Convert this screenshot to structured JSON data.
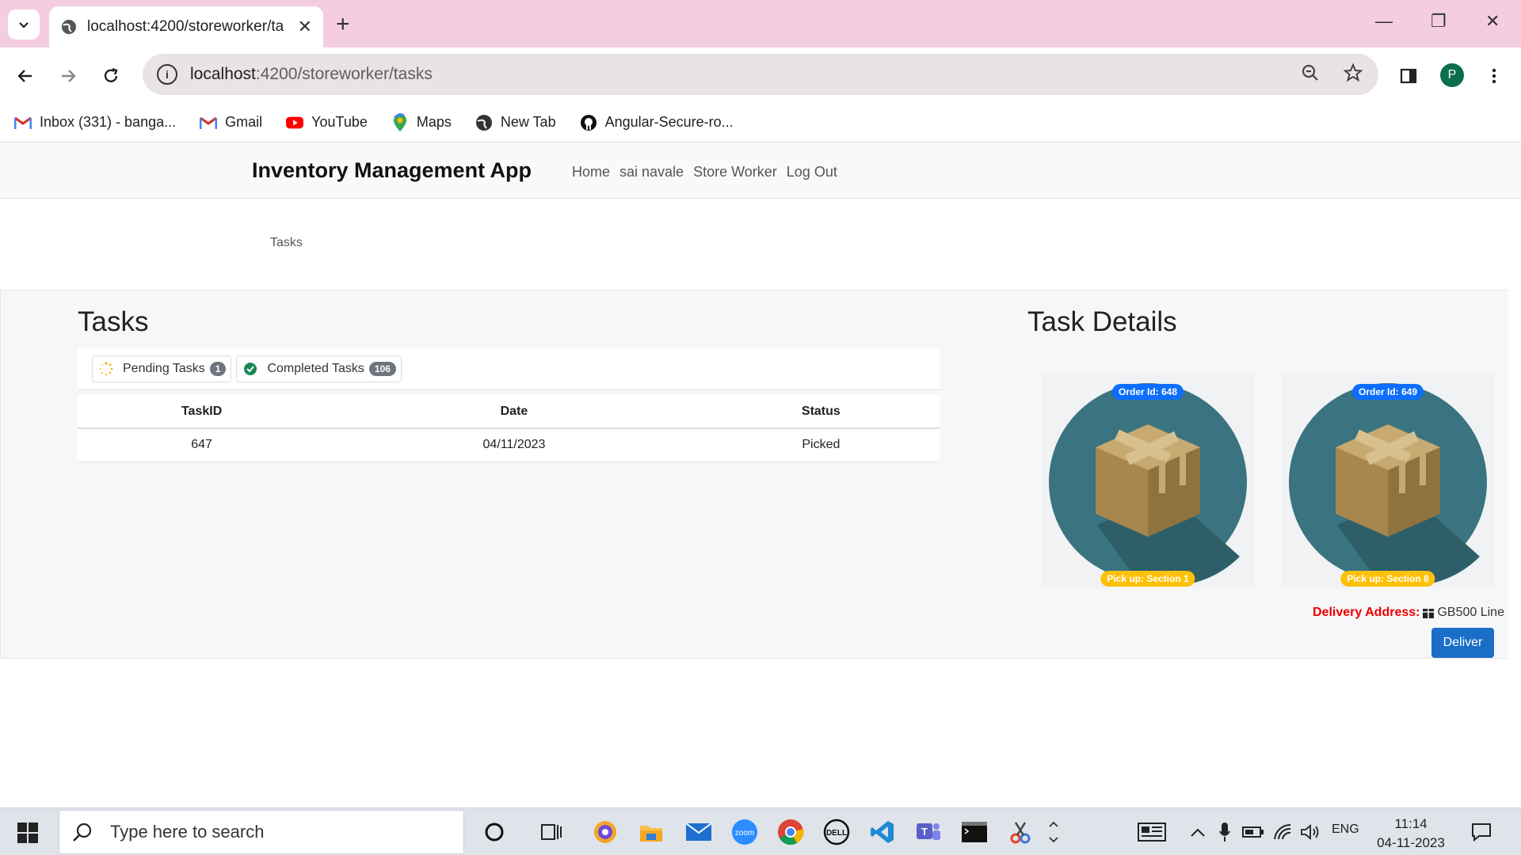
{
  "browser": {
    "tab_title": "localhost:4200/storeworker/ta",
    "url_host": "localhost",
    "url_path": ":4200/storeworker/tasks",
    "avatar_letter": "P",
    "bookmarks": [
      {
        "label": "Inbox (331) - banga...",
        "icon": "gmail-icon"
      },
      {
        "label": "Gmail",
        "icon": "gmail-icon"
      },
      {
        "label": "YouTube",
        "icon": "youtube-icon"
      },
      {
        "label": "Maps",
        "icon": "maps-icon"
      },
      {
        "label": "New Tab",
        "icon": "globe-icon"
      },
      {
        "label": "Angular-Secure-ro...",
        "icon": "github-icon"
      }
    ]
  },
  "app": {
    "brand": "Inventory Management App",
    "nav": [
      "Home",
      "sai navale",
      "Store Worker",
      "Log Out"
    ],
    "breadcrumb": "Tasks"
  },
  "tasks": {
    "heading": "Tasks",
    "tabs": [
      {
        "label": "Pending Tasks",
        "count": "1"
      },
      {
        "label": "Completed Tasks",
        "count": "106"
      }
    ],
    "columns": [
      "TaskID",
      "Date",
      "Status"
    ],
    "rows": [
      {
        "id": "647",
        "date": "04/11/2023",
        "status": "Picked"
      }
    ]
  },
  "details": {
    "heading": "Task Details",
    "cards": [
      {
        "order": "Order Id: 648",
        "pickup": "Pick up: Section 1"
      },
      {
        "order": "Order Id: 649",
        "pickup": "Pick up: Section 8"
      }
    ],
    "address_label": "Delivery Address:",
    "address_value": "GB500 Line",
    "deliver_label": "Deliver"
  },
  "taskbar": {
    "search_placeholder": "Type here to search",
    "lang": "ENG",
    "time": "11:14",
    "date": "04-11-2023"
  },
  "colors": {
    "accent": "#0d6efd",
    "warning": "#ffc107",
    "danger": "#ee0000",
    "deliver_button": "#1a6ec8",
    "browser_frame": "#f5cde0"
  }
}
